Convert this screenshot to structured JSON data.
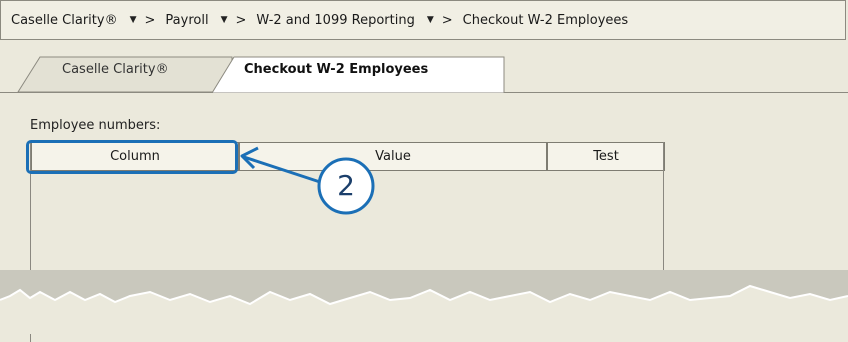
{
  "breadcrumb": {
    "items": [
      {
        "label": "Caselle Clarity®",
        "has_dropdown": true
      },
      {
        "label": "Payroll",
        "has_dropdown": true
      },
      {
        "label": "W-2 and 1099 Reporting",
        "has_dropdown": true
      },
      {
        "label": "Checkout W-2 Employees",
        "has_dropdown": false
      }
    ],
    "separator": ">",
    "dropdown_icon": "triangle-down-icon"
  },
  "tabs": [
    {
      "label": "Caselle Clarity®",
      "active": false
    },
    {
      "label": "Checkout W-2 Employees",
      "active": true
    }
  ],
  "employee_numbers": {
    "label": "Employee numbers:",
    "columns": [
      "Column",
      "Value",
      "Test"
    ]
  },
  "annotation": {
    "step_number": "2",
    "color": "#1b6fb6"
  }
}
